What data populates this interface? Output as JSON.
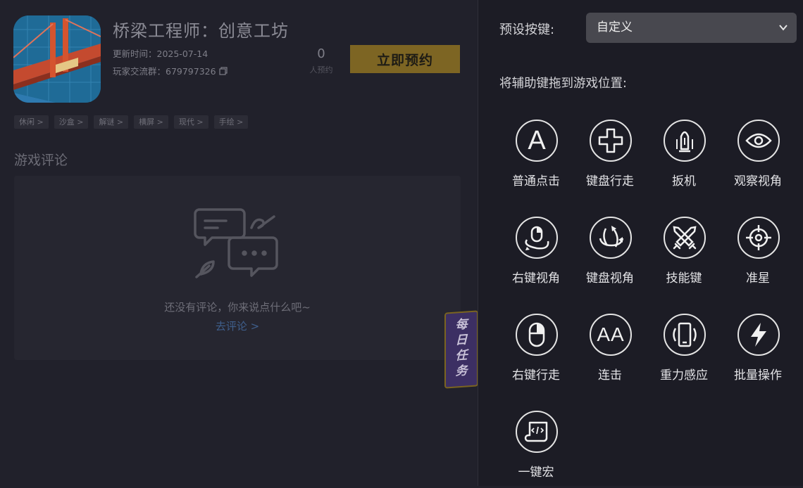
{
  "game": {
    "title": "桥梁工程师：创意工坊",
    "update_time": "更新时间：2025-07-14",
    "player_group": "玩家交流群：679797326",
    "reserve_count": "0",
    "reserve_label": "人预约",
    "reserve_button": "立即预约",
    "tags": [
      "休闲 >",
      "沙盒 >",
      "解谜 >",
      "横屏 >",
      "现代 >",
      "手绘 >"
    ]
  },
  "reviews": {
    "heading": "游戏评论",
    "empty_text": "还没有评论，你来说点什么吧~",
    "write_link": "去评论 >"
  },
  "daily_task": {
    "text": "每日任务"
  },
  "panel": {
    "preset_label": "预设按键:",
    "preset_value": "自定义",
    "drag_hint": "将辅助键拖到游戏位置:",
    "tools": [
      {
        "label": "普通点击",
        "icon": "letter-a-icon"
      },
      {
        "label": "键盘行走",
        "icon": "dpad-icon"
      },
      {
        "label": "扳机",
        "icon": "bullet-icon"
      },
      {
        "label": "观察视角",
        "icon": "eye-icon"
      },
      {
        "label": "右键视角",
        "icon": "mouse-rotate-icon"
      },
      {
        "label": "键盘视角",
        "icon": "rotate-view-icon"
      },
      {
        "label": "技能键",
        "icon": "crossed-swords-icon"
      },
      {
        "label": "准星",
        "icon": "crosshair-icon"
      },
      {
        "label": "右键行走",
        "icon": "mouse-icon"
      },
      {
        "label": "连击",
        "icon": "double-a-icon"
      },
      {
        "label": "重力感应",
        "icon": "phone-shake-icon"
      },
      {
        "label": "批量操作",
        "icon": "lightning-icon"
      },
      {
        "label": "一键宏",
        "icon": "script-icon"
      }
    ],
    "tool_letters": {
      "single": "A",
      "double": "AA"
    }
  }
}
